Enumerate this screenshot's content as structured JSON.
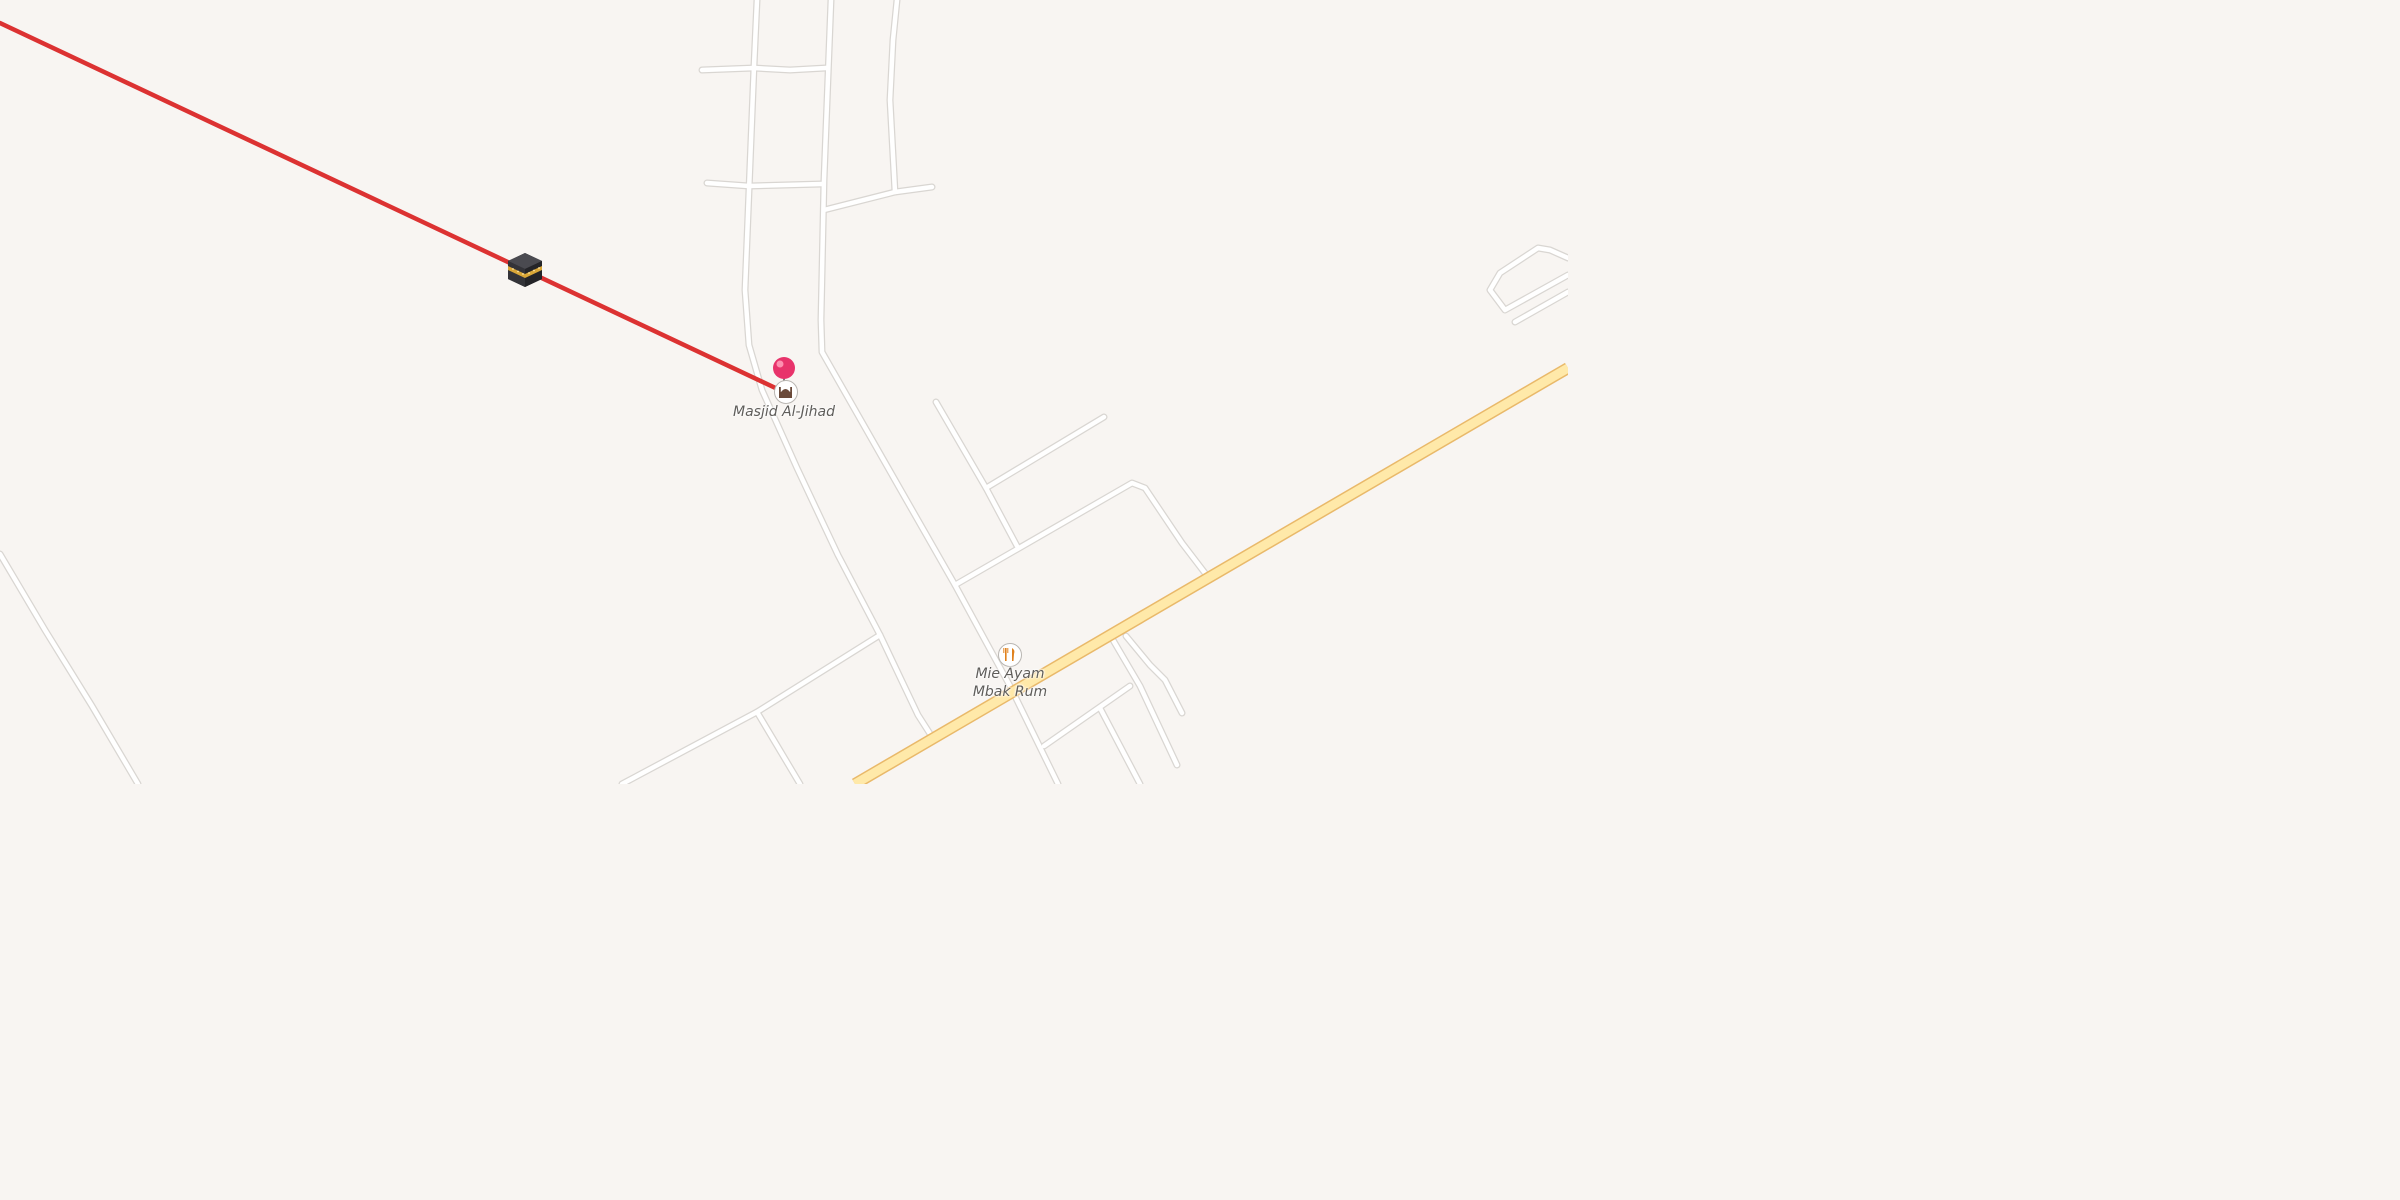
{
  "map": {
    "background_color": "#f8f5f2",
    "minor_road_color": "#ffffff",
    "main_road_color": "#ffe9a9",
    "qibla_line_color": "#dc3232"
  },
  "markers": {
    "kaaba": {
      "icon": "kaaba-icon"
    },
    "location_pin": {
      "icon": "map-pin-icon",
      "color": "#e8336b"
    }
  },
  "pois": [
    {
      "name": "Masjid Al-Jihad",
      "icon": "mosque-icon"
    },
    {
      "name_line1": "Mie Ayam",
      "name_line2": "Mbak Rum",
      "icon": "restaurant-icon"
    }
  ]
}
